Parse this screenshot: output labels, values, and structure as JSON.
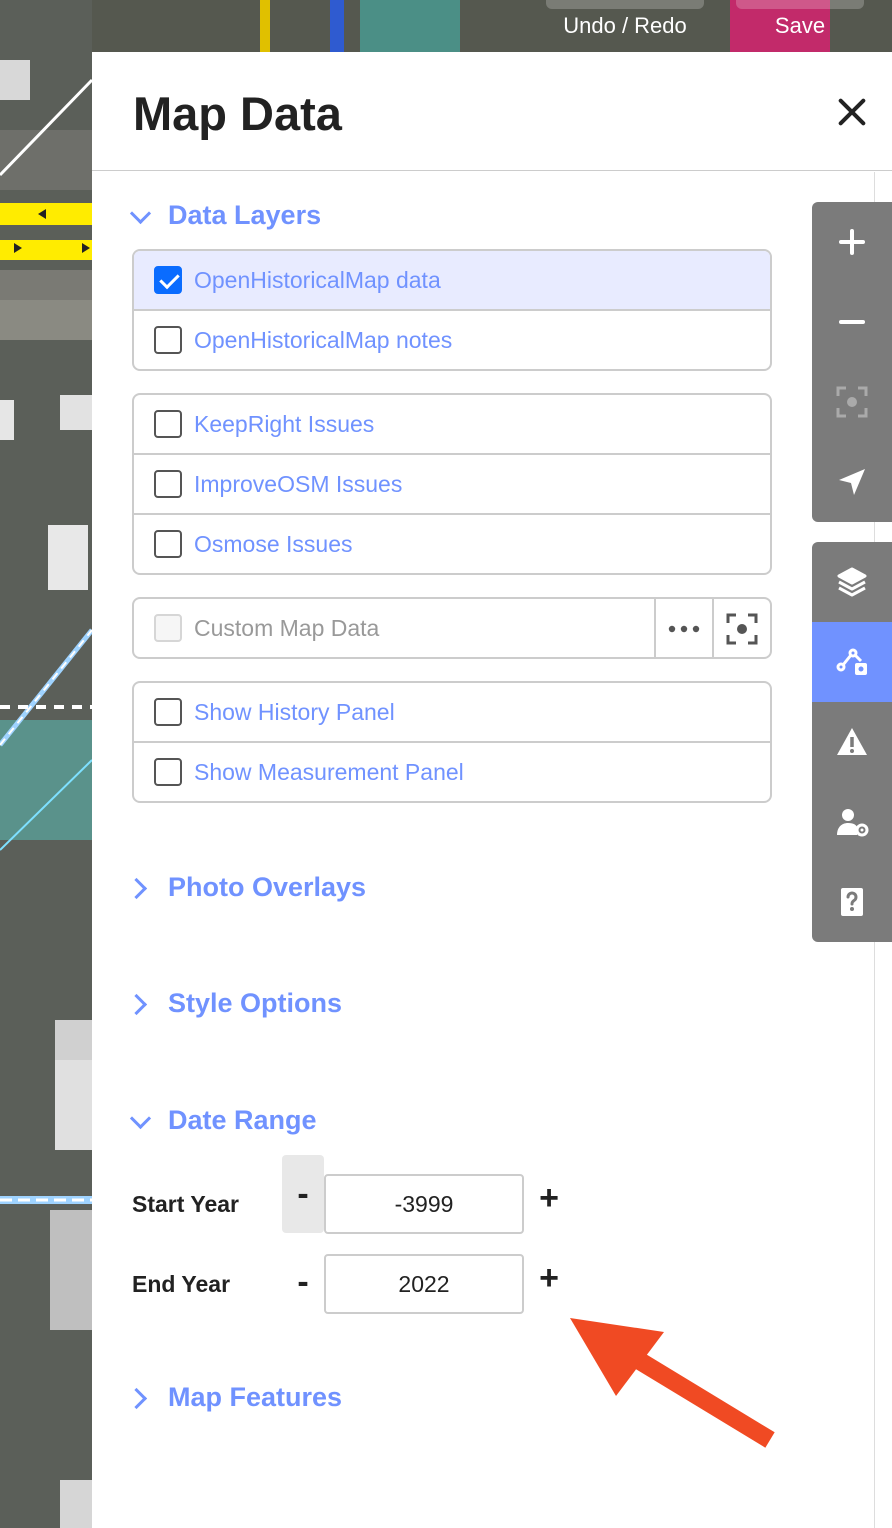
{
  "topbar": {
    "undo_redo": "Undo / Redo",
    "save": "Save"
  },
  "panel": {
    "title": "Map Data"
  },
  "sections": {
    "data_layers": "Data Layers",
    "photo_overlays": "Photo Overlays",
    "style_options": "Style Options",
    "date_range": "Date Range",
    "map_features": "Map Features"
  },
  "layers": {
    "ohm_data": {
      "label": "OpenHistoricalMap data",
      "checked": true
    },
    "ohm_notes": {
      "label": "OpenHistoricalMap notes",
      "checked": false
    },
    "keepright": {
      "label": "KeepRight Issues",
      "checked": false
    },
    "improveosm": {
      "label": "ImproveOSM Issues",
      "checked": false
    },
    "osmose": {
      "label": "Osmose Issues",
      "checked": false
    },
    "custom": {
      "label": "Custom Map Data",
      "checked": false,
      "more_icon": "ellipsis-icon",
      "zoom_icon": "zoom-to-data-icon"
    },
    "history": {
      "label": "Show History Panel",
      "checked": false
    },
    "measurement": {
      "label": "Show Measurement Panel",
      "checked": false
    }
  },
  "date_range": {
    "start_label": "Start Year",
    "start_value": "-3999",
    "end_label": "End Year",
    "end_value": "2022",
    "minus": "-",
    "plus": "+"
  },
  "toolbar": {
    "icons": [
      "zoom-in-icon",
      "zoom-out-icon",
      "zoom-to-selection-icon",
      "geolocate-icon",
      "background-layers-icon",
      "map-data-icon",
      "issues-icon",
      "preferences-icon",
      "help-icon"
    ],
    "active": "map-data-icon"
  },
  "colors": {
    "accent": "#7092ff",
    "checkbox": "#0a6cff",
    "active_row": "#e8ebff",
    "toolbar": "#7b7b7b",
    "annotation_arrow": "#f04a23"
  }
}
